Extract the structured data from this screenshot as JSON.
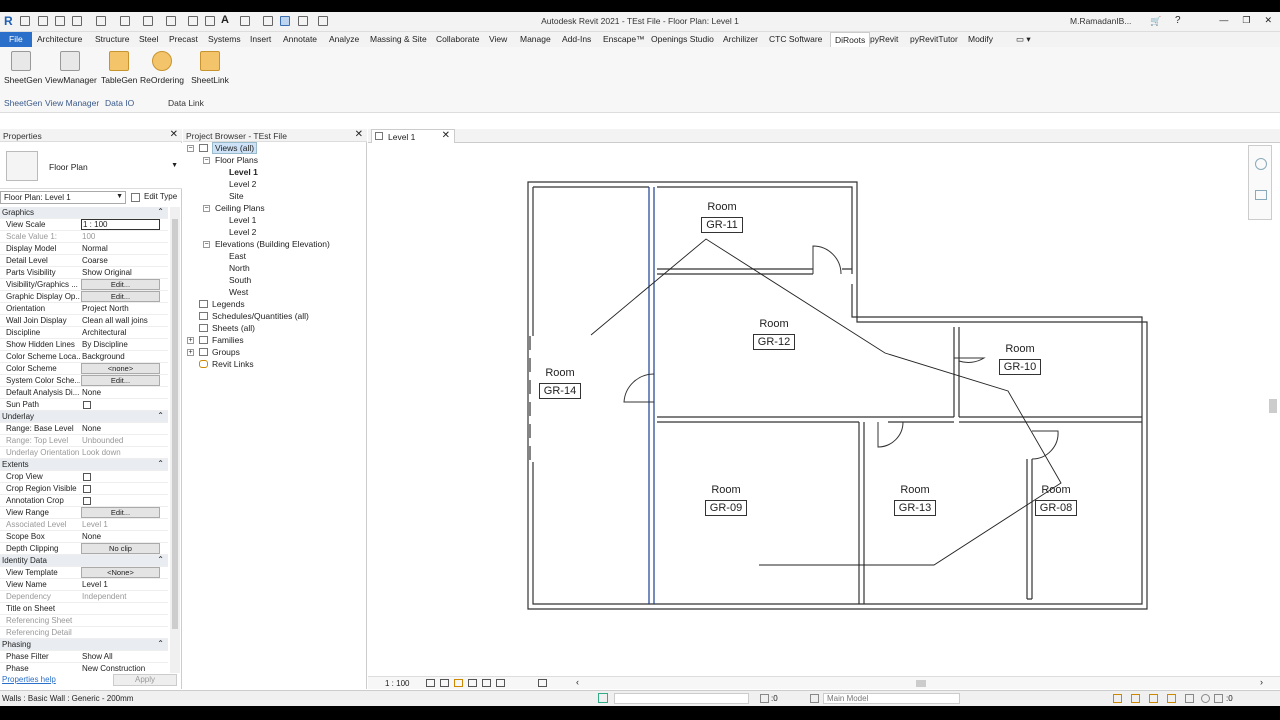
{
  "app": {
    "title": "Autodesk Revit 2021 - TEst File - Floor Plan: Level 1",
    "user": "M.RamadanIB...",
    "logo": "R"
  },
  "menu": {
    "items": [
      "File",
      "Architecture",
      "Structure",
      "Steel",
      "Precast",
      "Systems",
      "Insert",
      "Annotate",
      "Analyze",
      "Massing & Site",
      "Collaborate",
      "View",
      "Manage",
      "Add-Ins",
      "Enscape™",
      "Openings Studio",
      "Archilizer",
      "CTC Software",
      "DiRoots",
      "pyRevit",
      "pyRevitTutor",
      "Modify"
    ],
    "active": "DiRoots"
  },
  "ribbon": {
    "buttons": [
      "SheetGen",
      "ViewManager",
      "TableGen",
      "ReOrdering",
      "SheetLink"
    ],
    "groups": [
      "SheetGen",
      "View Manager",
      "Data IO",
      "Data Link"
    ]
  },
  "properties": {
    "title": "Properties",
    "type_name": "Floor Plan",
    "selector": "Floor Plan: Level 1",
    "edit_type": "Edit Type",
    "rows": [
      {
        "k": "Graphics",
        "group": true
      },
      {
        "k": "View Scale",
        "v": "1 : 100"
      },
      {
        "k": "Scale Value    1:",
        "v": "100",
        "grey": true
      },
      {
        "k": "Display Model",
        "v": "Normal"
      },
      {
        "k": "Detail Level",
        "v": "Coarse"
      },
      {
        "k": "Parts Visibility",
        "v": "Show Original"
      },
      {
        "k": "Visibility/Graphics ...",
        "btn": "Edit..."
      },
      {
        "k": "Graphic Display Op...",
        "btn": "Edit..."
      },
      {
        "k": "Orientation",
        "v": "Project North"
      },
      {
        "k": "Wall Join Display",
        "v": "Clean all wall joins"
      },
      {
        "k": "Discipline",
        "v": "Architectural"
      },
      {
        "k": "Show Hidden Lines",
        "v": "By Discipline"
      },
      {
        "k": "Color Scheme Loca...",
        "v": "Background"
      },
      {
        "k": "Color Scheme",
        "btn": "<none>"
      },
      {
        "k": "System Color Sche...",
        "btn": "Edit..."
      },
      {
        "k": "Default Analysis Di...",
        "v": "None"
      },
      {
        "k": "Sun Path",
        "chk": true
      },
      {
        "k": "Underlay",
        "group": true
      },
      {
        "k": "Range: Base Level",
        "v": "None"
      },
      {
        "k": "Range: Top Level",
        "v": "Unbounded",
        "grey": true
      },
      {
        "k": "Underlay Orientation",
        "v": "Look down",
        "grey": true
      },
      {
        "k": "Extents",
        "group": true
      },
      {
        "k": "Crop View",
        "chk": true
      },
      {
        "k": "Crop Region Visible",
        "chk": true
      },
      {
        "k": "Annotation Crop",
        "chk": true
      },
      {
        "k": "View Range",
        "btn": "Edit..."
      },
      {
        "k": "Associated Level",
        "v": "Level 1",
        "grey": true
      },
      {
        "k": "Scope Box",
        "v": "None"
      },
      {
        "k": "Depth Clipping",
        "btn": "No clip"
      },
      {
        "k": "Identity Data",
        "group": true
      },
      {
        "k": "View Template",
        "btn": "<None>"
      },
      {
        "k": "View Name",
        "v": "Level 1"
      },
      {
        "k": "Dependency",
        "v": "Independent",
        "grey": true
      },
      {
        "k": "Title on Sheet",
        "v": ""
      },
      {
        "k": "Referencing Sheet",
        "v": "",
        "grey": true
      },
      {
        "k": "Referencing Detail",
        "v": "",
        "grey": true
      },
      {
        "k": "Phasing",
        "group": true
      },
      {
        "k": "Phase Filter",
        "v": "Show All"
      },
      {
        "k": "Phase",
        "v": "New Construction"
      }
    ],
    "help": "Properties help",
    "apply": "Apply"
  },
  "browser": {
    "title": "Project Browser - TEst File",
    "nodes": [
      {
        "t": "Views (all)",
        "lvl": 0,
        "sel": true
      },
      {
        "t": "Floor Plans",
        "lvl": 1
      },
      {
        "t": "Level 1",
        "lvl": 2,
        "bold": true
      },
      {
        "t": "Level 2",
        "lvl": 2
      },
      {
        "t": "Site",
        "lvl": 2
      },
      {
        "t": "Ceiling Plans",
        "lvl": 1
      },
      {
        "t": "Level 1",
        "lvl": 2
      },
      {
        "t": "Level 2",
        "lvl": 2
      },
      {
        "t": "Elevations (Building Elevation)",
        "lvl": 1
      },
      {
        "t": "East",
        "lvl": 2
      },
      {
        "t": "North",
        "lvl": 2
      },
      {
        "t": "South",
        "lvl": 2
      },
      {
        "t": "West",
        "lvl": 2
      },
      {
        "t": "Legends",
        "lvl": 0
      },
      {
        "t": "Schedules/Quantities (all)",
        "lvl": 0
      },
      {
        "t": "Sheets (all)",
        "lvl": 0
      },
      {
        "t": "Families",
        "lvl": 0
      },
      {
        "t": "Groups",
        "lvl": 0
      },
      {
        "t": "Revit Links",
        "lvl": 0
      }
    ]
  },
  "view": {
    "tab": "Level 1",
    "scale": "1 : 100"
  },
  "rooms": [
    {
      "name": "Room",
      "num": "GR-11"
    },
    {
      "name": "Room",
      "num": "GR-12"
    },
    {
      "name": "Room",
      "num": "GR-10"
    },
    {
      "name": "Room",
      "num": "GR-14"
    },
    {
      "name": "Room",
      "num": "GR-09"
    },
    {
      "name": "Room",
      "num": "GR-13"
    },
    {
      "name": "Room",
      "num": "GR-08"
    }
  ],
  "status": {
    "text": "Walls : Basic Wall : Generic - 200mm",
    "zero": ":0",
    "model": "Main Model"
  }
}
